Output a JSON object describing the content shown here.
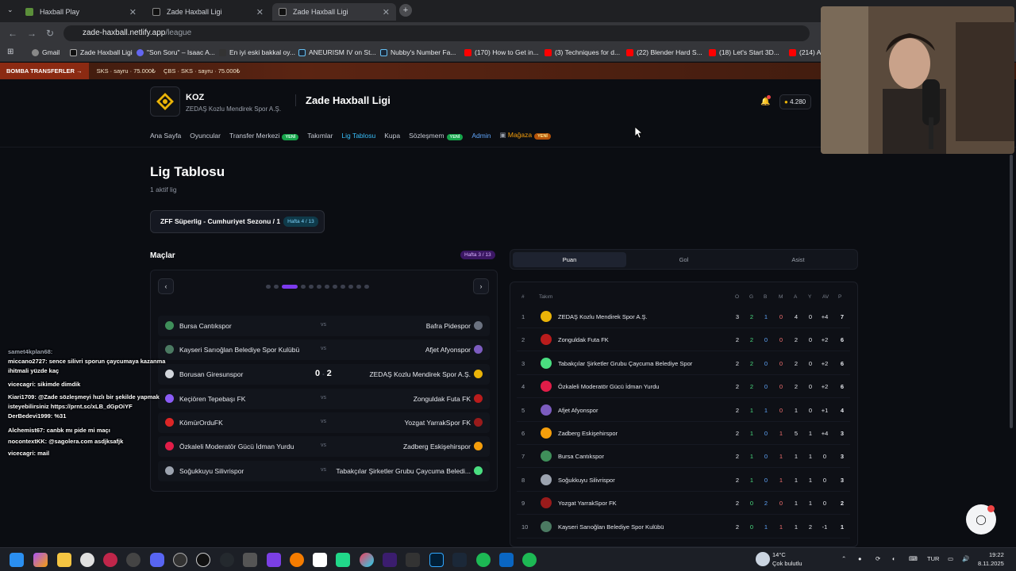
{
  "browser": {
    "tabs": [
      {
        "title": "Haxball Play",
        "active": false
      },
      {
        "title": "Zade Haxball Ligi",
        "active": false
      },
      {
        "title": "Zade Haxball Ligi",
        "active": true
      }
    ],
    "url_host": "zade-haxball.netlify.app",
    "url_path": "/league",
    "bookmarks": [
      "Gmail",
      "Zade Haxball Ligi",
      "\"Son Soru\" – Isaac A...",
      "En iyi eski bakkal oy...",
      "ANEURISM IV on St...",
      "Nubby's Number Fa...",
      "(170) How to Get in...",
      "(3) Techniques for d...",
      "(22) Blender Hard S...",
      "(18) Let's Start 3D...",
      "(214) A"
    ]
  },
  "ticker": {
    "label": "BOMBA TRANSFERLER",
    "items": [
      "SKS · sayru · 75.000₺",
      "ÇBS · SKS · sayru · 75.000₺"
    ]
  },
  "header": {
    "club_code": "KOZ",
    "club_name": "ZEDAŞ Kozlu Mendirek Spor A.Ş.",
    "brand": "Zade Haxball Ligi",
    "coins": "4.280"
  },
  "nav": {
    "items": [
      "Ana Sayfa",
      "Oyuncular",
      "Transfer Merkezi",
      "Takımlar",
      "Lig Tablosu",
      "Kupa",
      "Sözleşmem",
      "Admin",
      "Mağaza"
    ],
    "new_badge": "YENİ"
  },
  "page": {
    "title": "Lig Tablosu",
    "subtitle": "1 aktif lig",
    "season": "ZFF Süperlig - Cumhuriyet Sezonu / 1",
    "season_week": "Hafta 4 / 13"
  },
  "matches": {
    "title": "Maçlar",
    "week": "Hafta 3 / 13",
    "vs": "vs",
    "list": [
      {
        "home": "Bursa Cantıkspor",
        "away": "Bafra Pidespor",
        "score_home": "",
        "score_away": "",
        "hc": "#3f8f5a",
        "ac": "#6b7280"
      },
      {
        "home": "Kayseri Sarıoğlan Belediye Spor Kulübü",
        "away": "Afjet Afyonspor",
        "score_home": "",
        "score_away": "",
        "hc": "#4b7a62",
        "ac": "#7c5cbf"
      },
      {
        "home": "Borusan Giresunspor",
        "away": "ZEDAŞ Kozlu Mendirek Spor A.Ş.",
        "score_home": "0",
        "score_away": "2",
        "hc": "#d1d5db",
        "ac": "#eab308"
      },
      {
        "home": "Keçiören Tepebaşı FK",
        "away": "Zonguldak Futa FK",
        "score_home": "",
        "score_away": "",
        "hc": "#8b5cf6",
        "ac": "#b91c1c"
      },
      {
        "home": "KömürOrduFK",
        "away": "Yozgat YarrakSpor FK",
        "score_home": "",
        "score_away": "",
        "hc": "#dc2626",
        "ac": "#991b1b"
      },
      {
        "home": "Özkaleli Moderatör Gücü İdman Yurdu",
        "away": "Zadberg Eskişehirspor",
        "score_home": "",
        "score_away": "",
        "hc": "#e11d48",
        "ac": "#f59e0b"
      },
      {
        "home": "Soğukkuyu Silivrispor",
        "away": "Tabakçılar Şirketler Grubu Çaycuma Beledi...",
        "score_home": "",
        "score_away": "",
        "hc": "#9ca3af",
        "ac": "#4ade80"
      }
    ]
  },
  "standings": {
    "tabs": [
      "Puan",
      "Gol",
      "Asist"
    ],
    "headers": [
      "#",
      "Takım",
      "O",
      "G",
      "B",
      "M",
      "A",
      "Y",
      "AV",
      "P"
    ],
    "rows": [
      {
        "pos": "1",
        "team": "ZEDAŞ Kozlu Mendirek Spor A.Ş.",
        "o": "3",
        "g": "2",
        "b": "1",
        "m": "0",
        "a": "4",
        "y": "0",
        "av": "+4",
        "p": "7",
        "c": "#eab308"
      },
      {
        "pos": "2",
        "team": "Zonguldak Futa FK",
        "o": "2",
        "g": "2",
        "b": "0",
        "m": "0",
        "a": "2",
        "y": "0",
        "av": "+2",
        "p": "6",
        "c": "#b91c1c"
      },
      {
        "pos": "3",
        "team": "Tabakçılar Şirketler Grubu Çaycuma Belediye Spor",
        "o": "2",
        "g": "2",
        "b": "0",
        "m": "0",
        "a": "2",
        "y": "0",
        "av": "+2",
        "p": "6",
        "c": "#4ade80"
      },
      {
        "pos": "4",
        "team": "Özkaleli Moderatör Gücü İdman Yurdu",
        "o": "2",
        "g": "2",
        "b": "0",
        "m": "0",
        "a": "2",
        "y": "0",
        "av": "+2",
        "p": "6",
        "c": "#e11d48"
      },
      {
        "pos": "5",
        "team": "Afjet Afyonspor",
        "o": "2",
        "g": "1",
        "b": "1",
        "m": "0",
        "a": "1",
        "y": "0",
        "av": "+1",
        "p": "4",
        "c": "#7c5cbf"
      },
      {
        "pos": "6",
        "team": "Zadberg Eskişehirspor",
        "o": "2",
        "g": "1",
        "b": "0",
        "m": "1",
        "a": "5",
        "y": "1",
        "av": "+4",
        "p": "3",
        "c": "#f59e0b"
      },
      {
        "pos": "7",
        "team": "Bursa Cantıkspor",
        "o": "2",
        "g": "1",
        "b": "0",
        "m": "1",
        "a": "1",
        "y": "1",
        "av": "0",
        "p": "3",
        "c": "#3f8f5a"
      },
      {
        "pos": "8",
        "team": "Soğukkuyu Silivrispor",
        "o": "2",
        "g": "1",
        "b": "0",
        "m": "1",
        "a": "1",
        "y": "1",
        "av": "0",
        "p": "3",
        "c": "#9ca3af"
      },
      {
        "pos": "9",
        "team": "Yozgat YarrakSpor FK",
        "o": "2",
        "g": "0",
        "b": "2",
        "m": "0",
        "a": "1",
        "y": "1",
        "av": "0",
        "p": "2",
        "c": "#991b1b"
      },
      {
        "pos": "10",
        "team": "Kayseri Sarıoğlan Belediye Spor Kulübü",
        "o": "2",
        "g": "0",
        "b": "1",
        "m": "1",
        "a": "1",
        "y": "2",
        "av": "-1",
        "p": "1",
        "c": "#4b7a62"
      }
    ]
  },
  "chat": [
    "samet4kplan68:",
    "miccano2727: sence silivri sporun çaycumaya kazanma",
    "ihitmali yüzde kaç",
    "vicecagri: sikimde dimdik",
    "Kiari1709: @Zade sözleşmeyi hızlı bir şekilde yapmak",
    "isteyebilirsiniz https://prnt.sc/xLB_dGpOiYF",
    "DerBedevi1999: %31",
    "Alchemist67: canbk mı pide mi maçı",
    "nocontextKK: @sagolera.com asdjksafjk",
    "vicecagri: mail"
  ],
  "taskbar": {
    "weather_temp": "14°C",
    "weather_desc": "Çok bulutlu",
    "lang": "TUR",
    "time": "19:22",
    "date": "8.11.2025"
  },
  "colors": {
    "accent": "#38bdf8",
    "purple": "#7c3aed",
    "bg": "#0b0d12"
  }
}
